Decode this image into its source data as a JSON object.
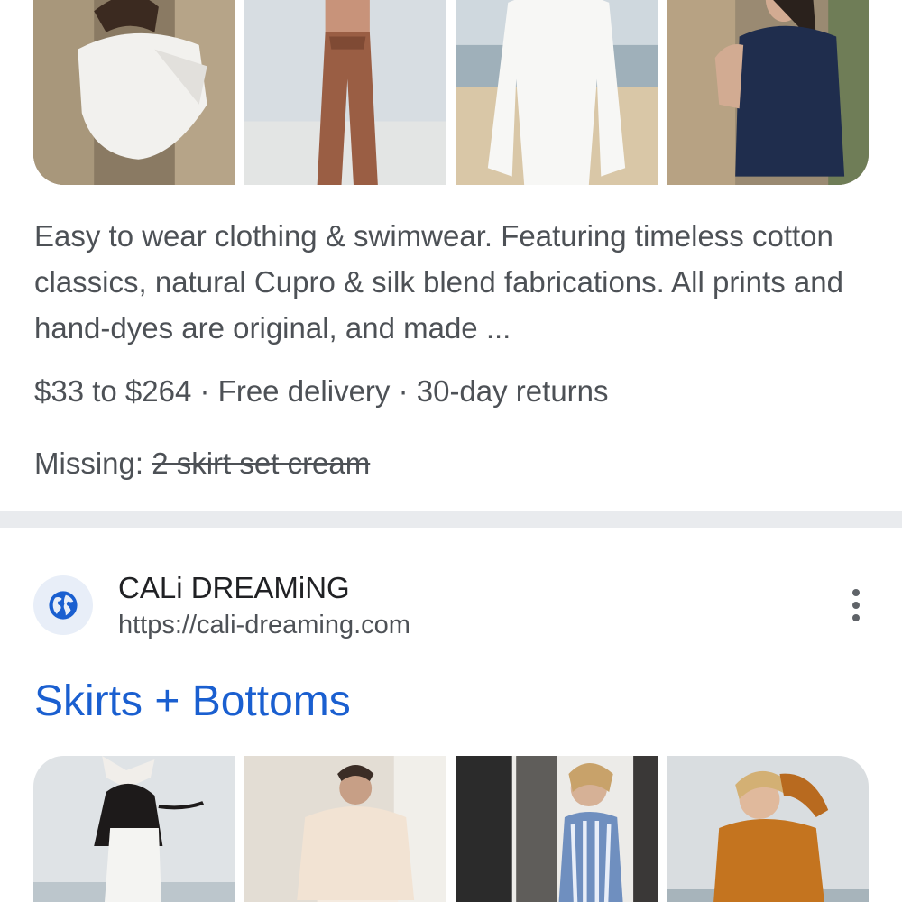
{
  "top_result": {
    "images": [
      "white-top-image",
      "brown-jumpsuit-image",
      "white-longsleeve-image",
      "navy-top-image"
    ],
    "description": "Easy to wear clothing & swimwear. Featuring timeless cotton classics, natural Cupro & silk blend fabrications. All prints and hand-dyes are original, and made ...",
    "price_range": "$33 to $264",
    "separator": " · ",
    "delivery": "Free delivery",
    "returns": "30-day returns",
    "missing_label": "Missing:",
    "missing_terms": "2 skirt set cream"
  },
  "second_result": {
    "site_name": "CALi DREAMiNG",
    "site_url": "https://cali-dreaming.com",
    "favicon": "globe-icon",
    "menu_icon": "more-vert-icon",
    "title": "Skirts + Bottoms",
    "images": [
      "white-top-skirt-image",
      "cream-blouse-image",
      "striped-dress-image",
      "orange-shirt-image"
    ]
  },
  "colors": {
    "link_blue": "#1a5fd0",
    "text_gray": "#4d5156",
    "divider": "#e9ebee"
  }
}
